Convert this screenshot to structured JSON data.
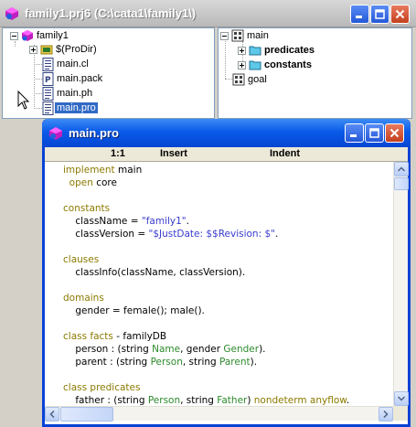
{
  "project_window": {
    "title": "family1.prj6 (C:\\cata1\\family1\\)",
    "buttons": {
      "minimize": "minimize",
      "maximize": "maximize",
      "close": "close"
    }
  },
  "project_tree": {
    "root": "family1",
    "items": [
      "$(ProDir)",
      "main.cl",
      "main.pack",
      "main.ph",
      "main.pro"
    ],
    "selected": "main.pro"
  },
  "module_tree": {
    "root": "main",
    "children": [
      "predicates",
      "constants"
    ],
    "sibling": "goal"
  },
  "editor_window": {
    "title": "main.pro",
    "status": {
      "position": "1:1",
      "mode": "Insert",
      "indent": "Indent"
    },
    "lines": [
      {
        "parts": [
          [
            "kw",
            "implement"
          ],
          [
            "",
            " main"
          ]
        ]
      },
      {
        "parts": [
          [
            "kw",
            "  open"
          ],
          [
            "",
            " core"
          ]
        ]
      },
      {
        "parts": [
          [
            "",
            ""
          ]
        ]
      },
      {
        "parts": [
          [
            "kw",
            "constants"
          ]
        ]
      },
      {
        "parts": [
          [
            "",
            "    className = "
          ],
          [
            "str",
            "\"family1\""
          ],
          [
            "",
            "."
          ]
        ]
      },
      {
        "parts": [
          [
            "",
            "    classVersion = "
          ],
          [
            "str",
            "\"$JustDate: $$Revision: $\""
          ],
          [
            "",
            "."
          ]
        ]
      },
      {
        "parts": [
          [
            "",
            ""
          ]
        ]
      },
      {
        "parts": [
          [
            "kw",
            "clauses"
          ]
        ]
      },
      {
        "parts": [
          [
            "",
            "    classInfo(className, classVersion)."
          ]
        ]
      },
      {
        "parts": [
          [
            "",
            ""
          ]
        ]
      },
      {
        "parts": [
          [
            "kw",
            "domains"
          ]
        ]
      },
      {
        "parts": [
          [
            "",
            "    gender = female(); male()."
          ]
        ]
      },
      {
        "parts": [
          [
            "",
            ""
          ]
        ]
      },
      {
        "parts": [
          [
            "kw",
            "class facts"
          ],
          [
            "",
            " - familyDB"
          ]
        ]
      },
      {
        "parts": [
          [
            "",
            "    person : (string "
          ],
          [
            "typ",
            "Name"
          ],
          [
            "",
            ", gender "
          ],
          [
            "typ",
            "Gender"
          ],
          [
            "",
            ")."
          ]
        ]
      },
      {
        "parts": [
          [
            "",
            "    parent : (string "
          ],
          [
            "typ",
            "Person"
          ],
          [
            "",
            ", string "
          ],
          [
            "typ",
            "Parent"
          ],
          [
            "",
            ")."
          ]
        ]
      },
      {
        "parts": [
          [
            "",
            ""
          ]
        ]
      },
      {
        "parts": [
          [
            "kw",
            "class predicates"
          ]
        ]
      },
      {
        "parts": [
          [
            "",
            "    father : (string "
          ],
          [
            "typ",
            "Person"
          ],
          [
            "",
            ", string "
          ],
          [
            "typ",
            "Father"
          ],
          [
            "",
            ") "
          ],
          [
            "kw",
            "nondeterm anyflow"
          ],
          [
            "",
            "."
          ]
        ]
      }
    ]
  },
  "colors": {
    "editor_title": "#0a5ae8",
    "keyword": "#8b7a00",
    "string": "#3a3acf",
    "type": "#2c8a2c",
    "selection": "#316ac5"
  }
}
